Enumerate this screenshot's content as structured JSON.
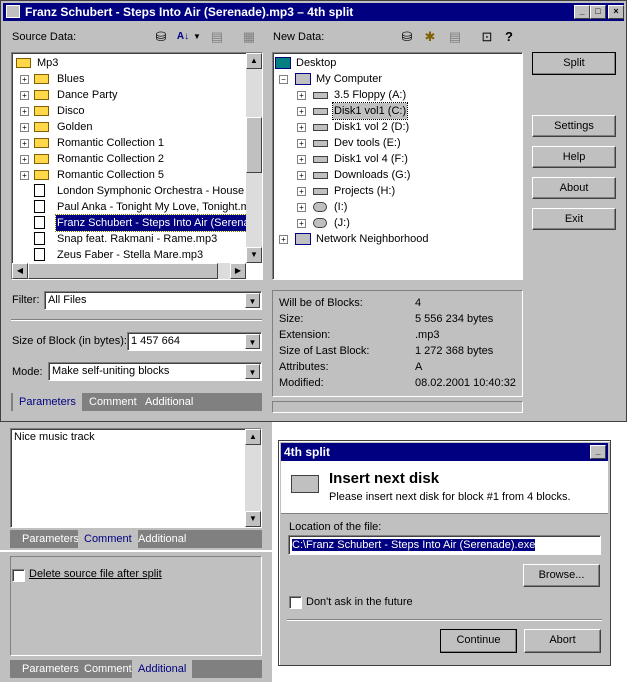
{
  "main_window": {
    "title": "Franz Schubert - Steps Into Air (Serenade).mp3 – 4th split",
    "source_label": "Source Data:",
    "new_label": "New Data:",
    "source_tree": [
      {
        "label": "Mp3",
        "kind": "folder"
      },
      {
        "label": "Blues",
        "kind": "folder"
      },
      {
        "label": "Dance Party",
        "kind": "folder"
      },
      {
        "label": "Disco",
        "kind": "folder"
      },
      {
        "label": "Golden",
        "kind": "folder"
      },
      {
        "label": "Romantic Collection 1",
        "kind": "folder"
      },
      {
        "label": "Romantic Collection 2",
        "kind": "folder"
      },
      {
        "label": "Romantic Collection 5",
        "kind": "folder"
      },
      {
        "label": "London Symphonic Orchestra - House Of",
        "kind": "file"
      },
      {
        "label": "Paul Anka - Tonight My Love, Tonight.mp",
        "kind": "file"
      },
      {
        "label": "Franz Schubert - Steps Into Air (Serenade",
        "kind": "file",
        "selected": true
      },
      {
        "label": "Snap feat. Rakmani - Rame.mp3",
        "kind": "file"
      },
      {
        "label": "Zeus Faber - Stella Mare.mp3",
        "kind": "file"
      }
    ],
    "new_tree": [
      {
        "label": "Desktop",
        "kind": "desktop"
      },
      {
        "label": "My Computer",
        "kind": "computer"
      },
      {
        "label": "3.5 Floppy (A:)",
        "kind": "drive"
      },
      {
        "label": "Disk1 vol1 (C:)",
        "kind": "drive",
        "selected": true
      },
      {
        "label": "Disk1 vol 2 (D:)",
        "kind": "drive"
      },
      {
        "label": "Dev tools (E:)",
        "kind": "drive"
      },
      {
        "label": "Disk1 vol 4 (F:)",
        "kind": "drive"
      },
      {
        "label": "Downloads (G:)",
        "kind": "drive"
      },
      {
        "label": "Projects (H:)",
        "kind": "drive"
      },
      {
        "label": "(I:)",
        "kind": "netdrive"
      },
      {
        "label": "(J:)",
        "kind": "netdrive"
      },
      {
        "label": "Network Neighborhood",
        "kind": "network"
      }
    ],
    "buttons": {
      "split": "Split",
      "settings": "Settings",
      "help": "Help",
      "about": "About",
      "exit": "Exit"
    },
    "filter_label": "Filter:",
    "filter_value": "All Files",
    "block_size_label": "Size of Block (in bytes):",
    "block_size_value": "1 457 664",
    "mode_label": "Mode:",
    "mode_value": "Make self-uniting blocks",
    "tabs": [
      "Parameters",
      "Comment",
      "Additional"
    ],
    "info": [
      {
        "key": "Will be of Blocks:",
        "value": "4"
      },
      {
        "key": "Size:",
        "value": "5 556 234 bytes"
      },
      {
        "key": "Extension:",
        "value": ".mp3"
      },
      {
        "key": "Size of Last Block:",
        "value": "1 272 368 bytes"
      },
      {
        "key": "Attributes:",
        "value": "A"
      },
      {
        "key": "Modified:",
        "value": "08.02.2001 10:40:32"
      }
    ]
  },
  "comment_panel": {
    "text": "Nice music track",
    "tabs": [
      "Parameters",
      "Comment",
      "Additional"
    ]
  },
  "additional_panel": {
    "checkbox_label": "Delete source file after split",
    "tabs": [
      "Parameters",
      "Comment",
      "Additional"
    ]
  },
  "dialog": {
    "title": "4th split",
    "heading": "Insert next disk",
    "message": "Please insert next disk for block #1 from 4 blocks.",
    "location_label": "Location of the file:",
    "location_value": "C:\\Franz Schubert - Steps Into Air (Serenade).exe",
    "browse": "Browse...",
    "dont_ask": "Don't ask in the future",
    "continue": "Continue",
    "abort": "Abort"
  }
}
